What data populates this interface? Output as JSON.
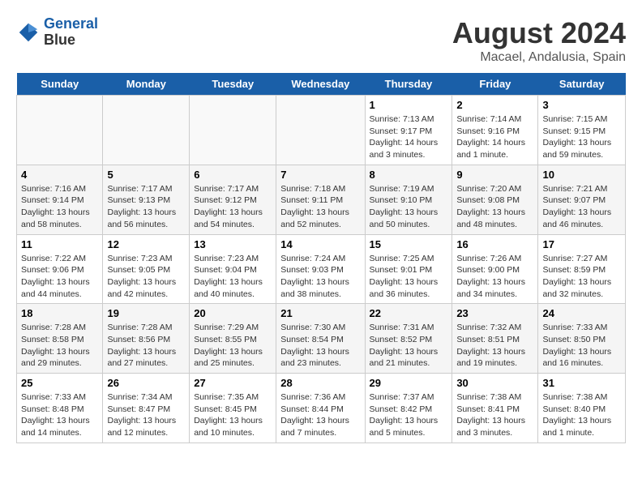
{
  "header": {
    "logo_line1": "General",
    "logo_line2": "Blue",
    "title": "August 2024",
    "subtitle": "Macael, Andalusia, Spain"
  },
  "calendar": {
    "weekdays": [
      "Sunday",
      "Monday",
      "Tuesday",
      "Wednesday",
      "Thursday",
      "Friday",
      "Saturday"
    ],
    "weeks": [
      [
        {
          "day": "",
          "info": ""
        },
        {
          "day": "",
          "info": ""
        },
        {
          "day": "",
          "info": ""
        },
        {
          "day": "",
          "info": ""
        },
        {
          "day": "1",
          "info": "Sunrise: 7:13 AM\nSunset: 9:17 PM\nDaylight: 14 hours\nand 3 minutes."
        },
        {
          "day": "2",
          "info": "Sunrise: 7:14 AM\nSunset: 9:16 PM\nDaylight: 14 hours\nand 1 minute."
        },
        {
          "day": "3",
          "info": "Sunrise: 7:15 AM\nSunset: 9:15 PM\nDaylight: 13 hours\nand 59 minutes."
        }
      ],
      [
        {
          "day": "4",
          "info": "Sunrise: 7:16 AM\nSunset: 9:14 PM\nDaylight: 13 hours\nand 58 minutes."
        },
        {
          "day": "5",
          "info": "Sunrise: 7:17 AM\nSunset: 9:13 PM\nDaylight: 13 hours\nand 56 minutes."
        },
        {
          "day": "6",
          "info": "Sunrise: 7:17 AM\nSunset: 9:12 PM\nDaylight: 13 hours\nand 54 minutes."
        },
        {
          "day": "7",
          "info": "Sunrise: 7:18 AM\nSunset: 9:11 PM\nDaylight: 13 hours\nand 52 minutes."
        },
        {
          "day": "8",
          "info": "Sunrise: 7:19 AM\nSunset: 9:10 PM\nDaylight: 13 hours\nand 50 minutes."
        },
        {
          "day": "9",
          "info": "Sunrise: 7:20 AM\nSunset: 9:08 PM\nDaylight: 13 hours\nand 48 minutes."
        },
        {
          "day": "10",
          "info": "Sunrise: 7:21 AM\nSunset: 9:07 PM\nDaylight: 13 hours\nand 46 minutes."
        }
      ],
      [
        {
          "day": "11",
          "info": "Sunrise: 7:22 AM\nSunset: 9:06 PM\nDaylight: 13 hours\nand 44 minutes."
        },
        {
          "day": "12",
          "info": "Sunrise: 7:23 AM\nSunset: 9:05 PM\nDaylight: 13 hours\nand 42 minutes."
        },
        {
          "day": "13",
          "info": "Sunrise: 7:23 AM\nSunset: 9:04 PM\nDaylight: 13 hours\nand 40 minutes."
        },
        {
          "day": "14",
          "info": "Sunrise: 7:24 AM\nSunset: 9:03 PM\nDaylight: 13 hours\nand 38 minutes."
        },
        {
          "day": "15",
          "info": "Sunrise: 7:25 AM\nSunset: 9:01 PM\nDaylight: 13 hours\nand 36 minutes."
        },
        {
          "day": "16",
          "info": "Sunrise: 7:26 AM\nSunset: 9:00 PM\nDaylight: 13 hours\nand 34 minutes."
        },
        {
          "day": "17",
          "info": "Sunrise: 7:27 AM\nSunset: 8:59 PM\nDaylight: 13 hours\nand 32 minutes."
        }
      ],
      [
        {
          "day": "18",
          "info": "Sunrise: 7:28 AM\nSunset: 8:58 PM\nDaylight: 13 hours\nand 29 minutes."
        },
        {
          "day": "19",
          "info": "Sunrise: 7:28 AM\nSunset: 8:56 PM\nDaylight: 13 hours\nand 27 minutes."
        },
        {
          "day": "20",
          "info": "Sunrise: 7:29 AM\nSunset: 8:55 PM\nDaylight: 13 hours\nand 25 minutes."
        },
        {
          "day": "21",
          "info": "Sunrise: 7:30 AM\nSunset: 8:54 PM\nDaylight: 13 hours\nand 23 minutes."
        },
        {
          "day": "22",
          "info": "Sunrise: 7:31 AM\nSunset: 8:52 PM\nDaylight: 13 hours\nand 21 minutes."
        },
        {
          "day": "23",
          "info": "Sunrise: 7:32 AM\nSunset: 8:51 PM\nDaylight: 13 hours\nand 19 minutes."
        },
        {
          "day": "24",
          "info": "Sunrise: 7:33 AM\nSunset: 8:50 PM\nDaylight: 13 hours\nand 16 minutes."
        }
      ],
      [
        {
          "day": "25",
          "info": "Sunrise: 7:33 AM\nSunset: 8:48 PM\nDaylight: 13 hours\nand 14 minutes."
        },
        {
          "day": "26",
          "info": "Sunrise: 7:34 AM\nSunset: 8:47 PM\nDaylight: 13 hours\nand 12 minutes."
        },
        {
          "day": "27",
          "info": "Sunrise: 7:35 AM\nSunset: 8:45 PM\nDaylight: 13 hours\nand 10 minutes."
        },
        {
          "day": "28",
          "info": "Sunrise: 7:36 AM\nSunset: 8:44 PM\nDaylight: 13 hours\nand 7 minutes."
        },
        {
          "day": "29",
          "info": "Sunrise: 7:37 AM\nSunset: 8:42 PM\nDaylight: 13 hours\nand 5 minutes."
        },
        {
          "day": "30",
          "info": "Sunrise: 7:38 AM\nSunset: 8:41 PM\nDaylight: 13 hours\nand 3 minutes."
        },
        {
          "day": "31",
          "info": "Sunrise: 7:38 AM\nSunset: 8:40 PM\nDaylight: 13 hours\nand 1 minute."
        }
      ]
    ]
  }
}
